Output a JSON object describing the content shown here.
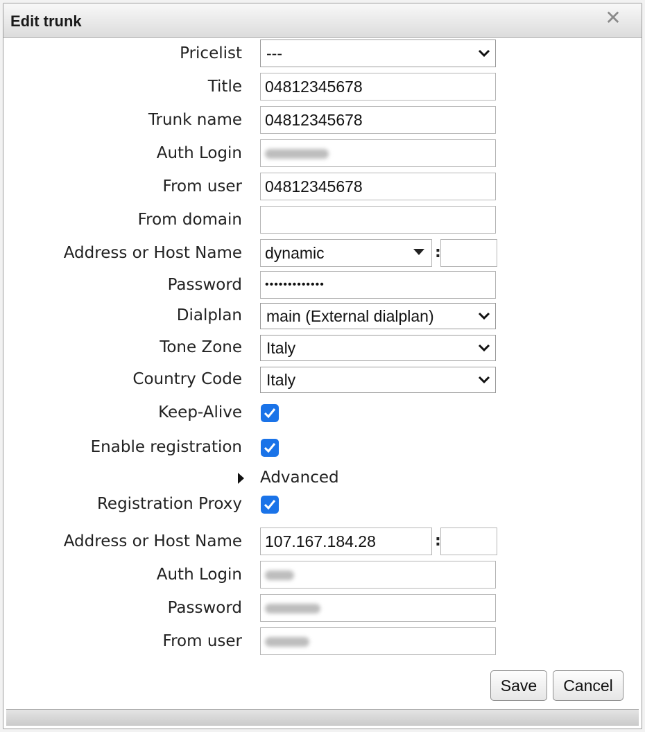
{
  "dialog": {
    "title": "Edit trunk",
    "close_glyph": "✕"
  },
  "form": {
    "pricelist": {
      "label": "Pricelist",
      "value": "---"
    },
    "title": {
      "label": "Title",
      "value": "04812345678"
    },
    "trunk_name": {
      "label": "Trunk name",
      "value": "04812345678"
    },
    "auth_login": {
      "label": "Auth Login",
      "value": ""
    },
    "from_user": {
      "label": "From user",
      "value": "04812345678"
    },
    "from_domain": {
      "label": "From domain",
      "value": ""
    },
    "host": {
      "label": "Address or Host Name",
      "value": "dynamic",
      "separator": ":",
      "port": ""
    },
    "password": {
      "label": "Password",
      "value": "•••••••••••••"
    },
    "dialplan": {
      "label": "Dialplan",
      "value": "main (External dialplan)"
    },
    "tone_zone": {
      "label": "Tone Zone",
      "value": "Italy"
    },
    "country_code": {
      "label": "Country Code",
      "value": "Italy"
    },
    "keep_alive": {
      "label": "Keep-Alive",
      "checked": true
    },
    "enable_registration": {
      "label": "Enable registration",
      "checked": true
    },
    "advanced": {
      "label": "Advanced"
    },
    "registration_proxy": {
      "label": "Registration Proxy",
      "checked": true
    },
    "proxy_host": {
      "label": "Address or Host Name",
      "value": "107.167.184.28",
      "separator": ":",
      "port": ""
    },
    "proxy_auth_login": {
      "label": "Auth Login",
      "value": ""
    },
    "proxy_password": {
      "label": "Password",
      "value": ""
    },
    "proxy_from_user": {
      "label": "From user",
      "value": ""
    }
  },
  "buttons": {
    "save": "Save",
    "cancel": "Cancel"
  },
  "colors": {
    "checkbox": "#1a73e8"
  }
}
